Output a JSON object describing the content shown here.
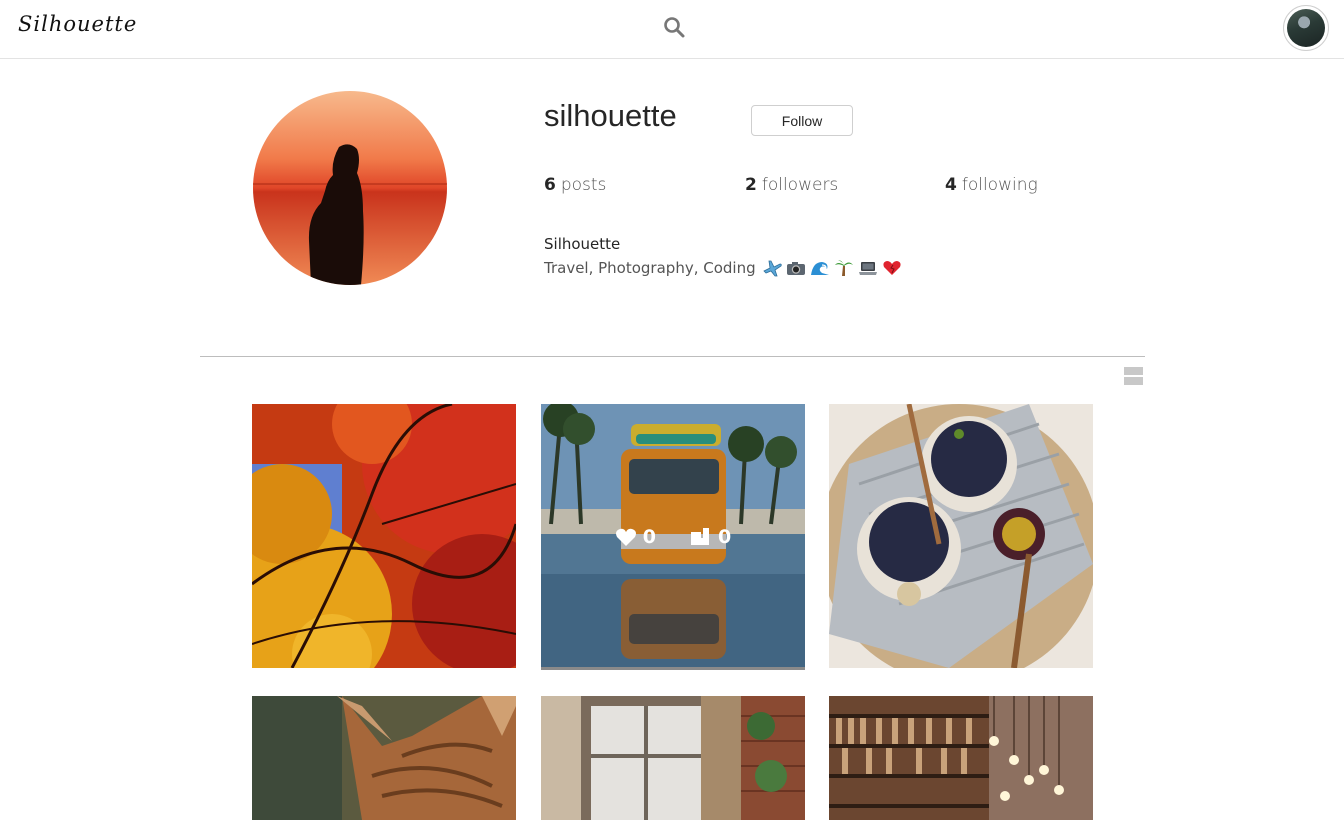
{
  "app": {
    "logo": "Silhouette"
  },
  "nav": {
    "search_icon": "search-icon",
    "avatar": "user-avatar"
  },
  "profile": {
    "username": "silhouette",
    "follow_label": "Follow",
    "stats": {
      "posts": {
        "count": "6",
        "label": "posts"
      },
      "followers": {
        "count": "2",
        "label": "followers"
      },
      "following": {
        "count": "4",
        "label": "following"
      }
    },
    "bio_name": "Silhouette",
    "bio_text": "Travel, Photography, Coding",
    "bio_emojis": [
      "airplane-emoji",
      "camera-emoji",
      "wave-emoji",
      "palm-tree-emoji",
      "laptop-emoji",
      "heart-emoji"
    ]
  },
  "posts": [
    {
      "subject": "autumn-leaves"
    },
    {
      "subject": "orange-van",
      "likes": "0",
      "comments": "0"
    },
    {
      "subject": "berry-parfait"
    },
    {
      "subject": "cat"
    },
    {
      "subject": "window-room"
    },
    {
      "subject": "library-bulbs"
    }
  ],
  "colors": {
    "accent_text": "#262626",
    "border": "#e3e3e3"
  }
}
